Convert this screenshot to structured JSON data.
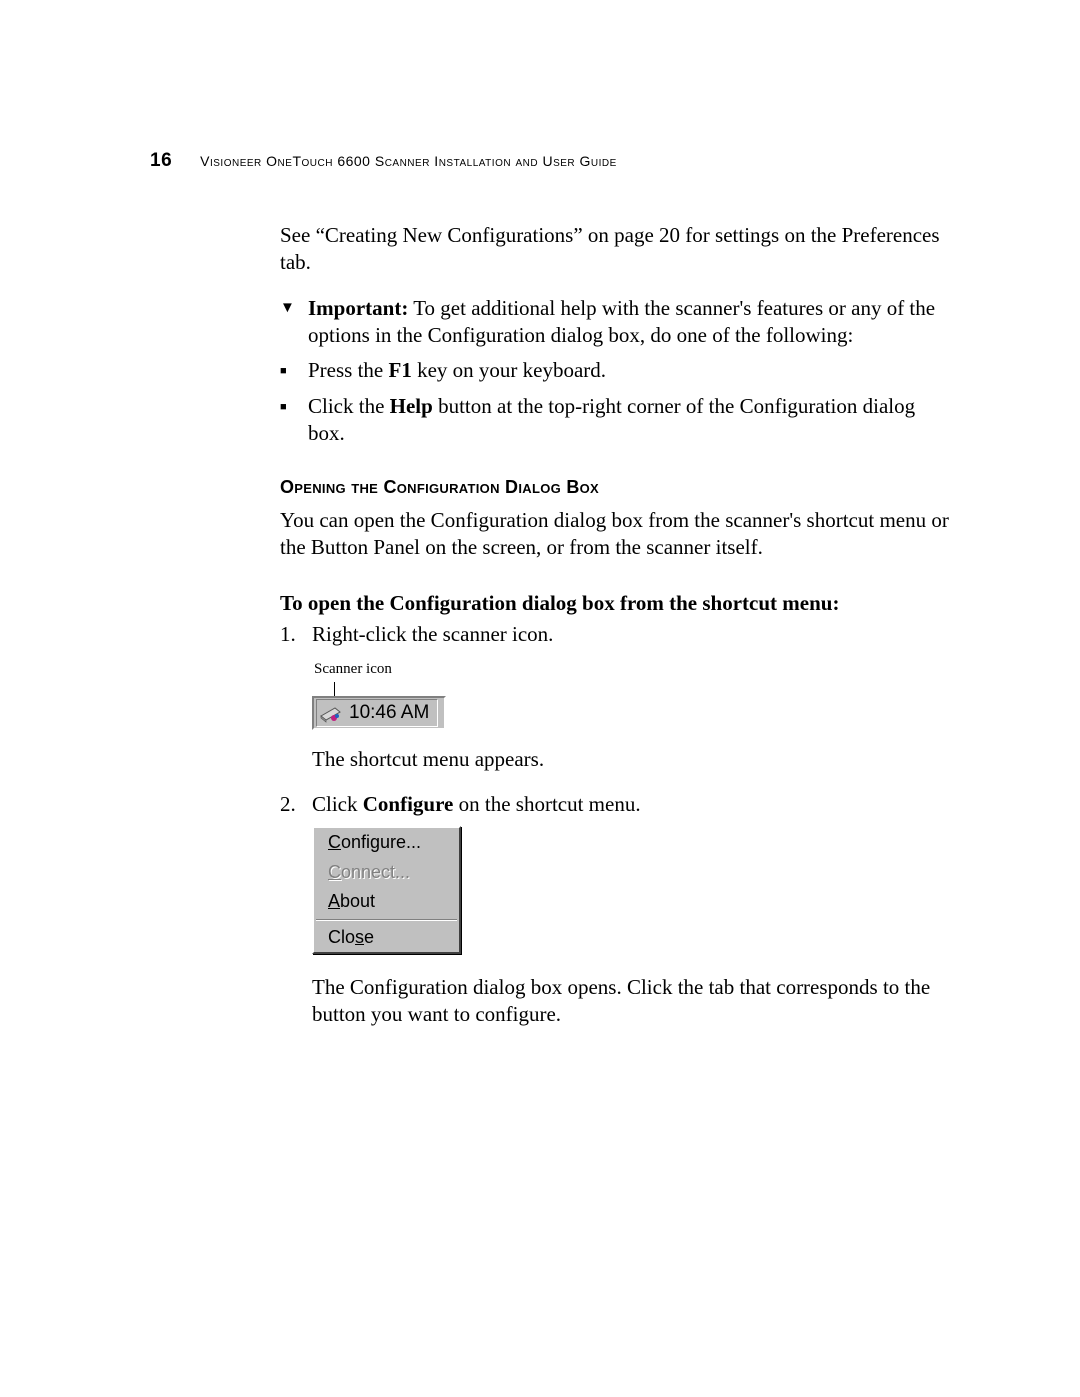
{
  "page_number": "16",
  "header_title": "Visioneer OneTouch 6600 Scanner Installation and User Guide",
  "intro_para": "See “Creating New Configurations” on page 20 for settings on the Preferences tab.",
  "important": {
    "label": "Important:",
    "text": " To get additional help with the scanner's features or any of the options in the Configuration dialog box, do one of the following:"
  },
  "bullets": {
    "b1_pre": "Press the ",
    "b1_key": "F1",
    "b1_post": " key on your keyboard.",
    "b2_pre": "Click the ",
    "b2_bold": "Help",
    "b2_post": " button at the top-right corner of the Configuration dialog box."
  },
  "section_heading": "Opening the Configuration Dialog Box",
  "section_para": "You can open the Configuration dialog box from the scanner's shortcut menu or the Button Panel on the screen, or from the scanner itself.",
  "subhead": "To open the Configuration dialog box from the shortcut menu:",
  "steps": {
    "s1": "Right-click the scanner icon.",
    "s1_caption": "Scanner icon",
    "tray_time": "10:46 AM",
    "s1_after": "The shortcut menu appears.",
    "s2_pre": "Click ",
    "s2_bold": "Configure",
    "s2_post": " on the shortcut menu.",
    "menu": {
      "configure_u": "C",
      "configure_rest": "onfigure...",
      "connect_u": "C",
      "connect_rest": "onnect...",
      "about_u": "A",
      "about_rest": "bout",
      "close_pre": "Clo",
      "close_u": "s",
      "close_post": "e"
    },
    "s2_after": "The Configuration dialog box opens. Click the tab that corresponds to the button you want to configure."
  }
}
